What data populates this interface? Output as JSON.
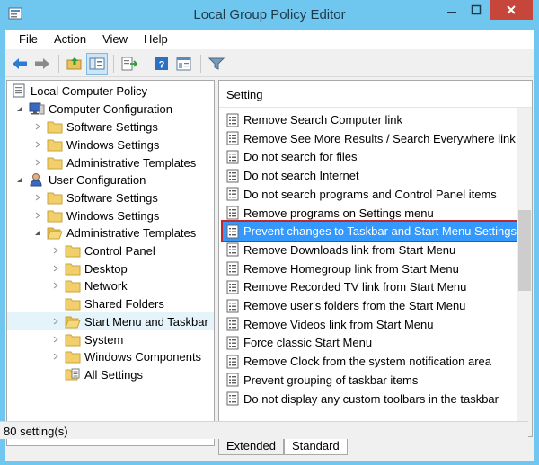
{
  "window": {
    "title": "Local Group Policy Editor"
  },
  "menu": [
    "File",
    "Action",
    "View",
    "Help"
  ],
  "toolbar": {
    "buttons": [
      "back-arrow-icon",
      "forward-arrow-icon",
      "up-folder-icon",
      "show-hide-tree-icon",
      "export-list-icon",
      "help-icon",
      "properties-icon",
      "filter-icon"
    ]
  },
  "tree": {
    "items": [
      {
        "label": "Local Computer Policy",
        "icon": "policy-root-icon"
      },
      {
        "label": "Computer Configuration",
        "icon": "computer-icon"
      },
      {
        "label": "Software Settings",
        "icon": "folder-icon"
      },
      {
        "label": "Windows Settings",
        "icon": "folder-icon"
      },
      {
        "label": "Administrative Templates",
        "icon": "folder-icon"
      },
      {
        "label": "User Configuration",
        "icon": "user-icon"
      },
      {
        "label": "Software Settings",
        "icon": "folder-icon"
      },
      {
        "label": "Windows Settings",
        "icon": "folder-icon"
      },
      {
        "label": "Administrative Templates",
        "icon": "folder-open-icon"
      },
      {
        "label": "Control Panel",
        "icon": "folder-icon"
      },
      {
        "label": "Desktop",
        "icon": "folder-icon"
      },
      {
        "label": "Network",
        "icon": "folder-icon"
      },
      {
        "label": "Shared Folders",
        "icon": "folder-icon"
      },
      {
        "label": "Start Menu and Taskbar",
        "icon": "folder-open-icon"
      },
      {
        "label": "System",
        "icon": "folder-icon"
      },
      {
        "label": "Windows Components",
        "icon": "folder-icon"
      },
      {
        "label": "All Settings",
        "icon": "all-settings-icon"
      }
    ]
  },
  "list": {
    "column_header": "Setting",
    "items": [
      "Remove Search Computer link",
      "Remove See More Results / Search Everywhere link",
      "Do not search for files",
      "Do not search Internet",
      "Do not search programs and Control Panel items",
      "Remove programs on Settings menu",
      "Prevent changes to Taskbar and Start Menu Settings",
      "Remove Downloads link from Start Menu",
      "Remove Homegroup link from Start Menu",
      "Remove Recorded TV link from Start Menu",
      "Remove user's folders from the Start Menu",
      "Remove Videos link from Start Menu",
      "Force classic Start Menu",
      "Remove Clock from the system notification area",
      "Prevent grouping of taskbar items",
      "Do not display any custom toolbars in the taskbar"
    ],
    "selected_index": 6
  },
  "tabs": [
    "Extended",
    "Standard"
  ],
  "status": {
    "text": "80 setting(s)"
  },
  "colors": {
    "titlebar": "#6fc7ef",
    "selection": "#3399ff",
    "highlight_box": "#c1272d",
    "close_button": "#c7463c"
  }
}
